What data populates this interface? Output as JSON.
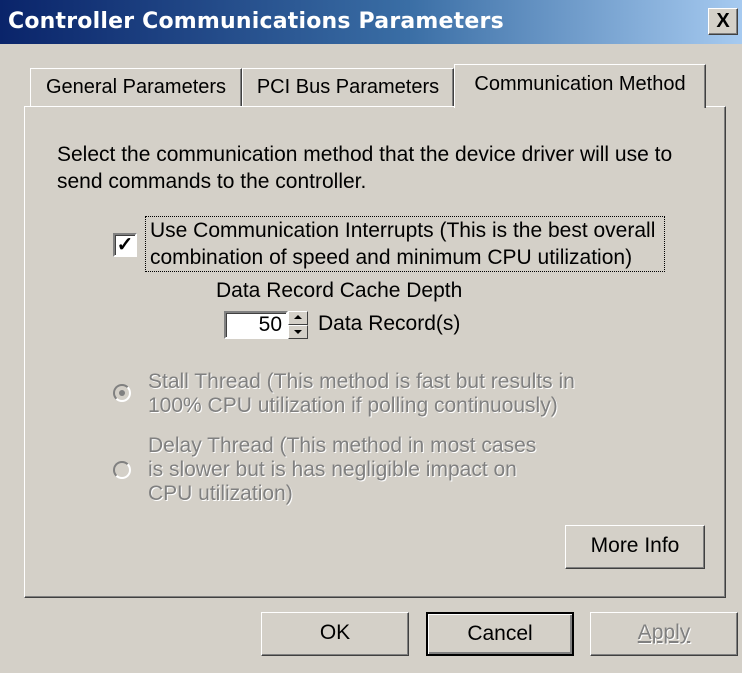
{
  "window": {
    "title": "Controller Communications Parameters",
    "close_glyph": "X"
  },
  "tabs": [
    {
      "label": "General Parameters",
      "active": false
    },
    {
      "label": "PCI Bus Parameters",
      "active": false
    },
    {
      "label": "Communication Method",
      "active": true
    }
  ],
  "panel": {
    "description": "Select the communication method that the device driver will use to send commands to the controller.",
    "interrupts_checkbox": {
      "checked": true,
      "check_glyph": "✓",
      "label": "Use Communication Interrupts (This is the best overall combination of speed and minimum CPU utilization)"
    },
    "cache_depth": {
      "label": "Data Record Cache Depth",
      "value": "50",
      "unit": "Data Record(s)"
    },
    "stall_thread": {
      "label": "Stall Thread (This method is fast but results in 100% CPU utilization if polling continuously)",
      "selected": true,
      "enabled": false
    },
    "delay_thread": {
      "label": "Delay Thread (This method in most cases is slower but is has negligible impact on CPU utilization)",
      "selected": false,
      "enabled": false
    },
    "more_info_label": "More Info"
  },
  "footer": {
    "ok_label": "OK",
    "cancel_label": "Cancel",
    "apply_label": "Apply"
  },
  "colors": {
    "face": "#d4d0c8",
    "title_start": "#0a246a",
    "title_end": "#a6caf0",
    "disabled_text": "#808080"
  }
}
